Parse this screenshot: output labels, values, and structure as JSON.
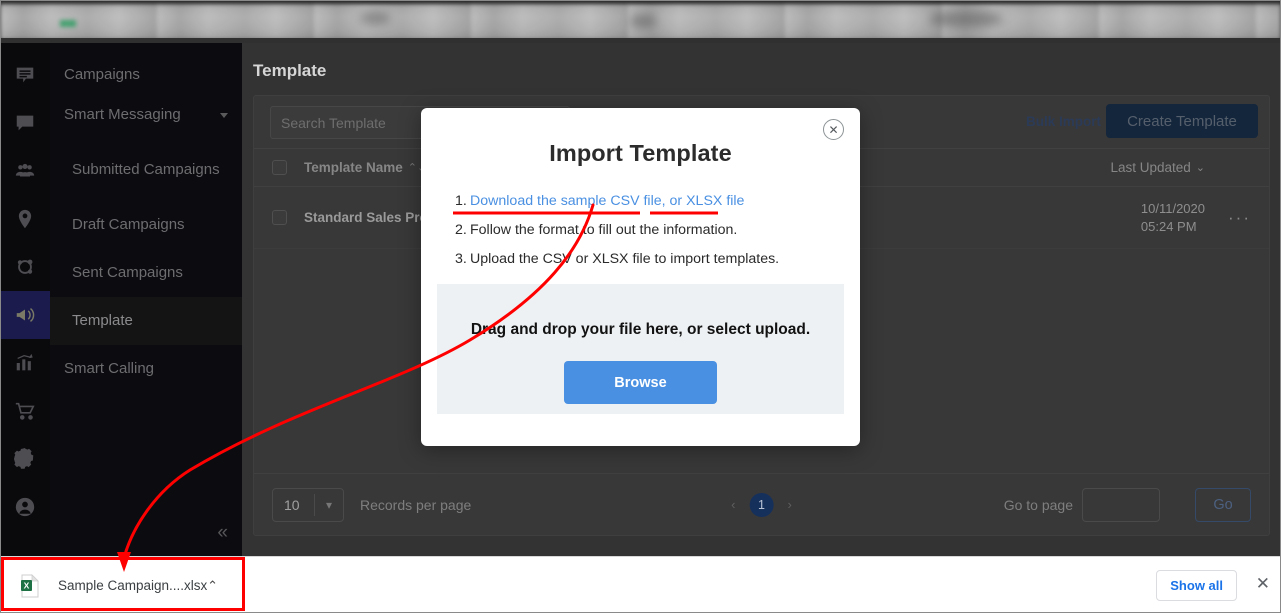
{
  "browser": {
    "chrome_note": "blurred-toolbar"
  },
  "sidebar": {
    "rail_icons": [
      {
        "name": "message-list-icon"
      },
      {
        "name": "chat-bubble-icon"
      },
      {
        "name": "people-group-icon"
      },
      {
        "name": "location-pin-icon"
      },
      {
        "name": "share-network-icon"
      },
      {
        "name": "megaphone-icon",
        "active": true
      },
      {
        "name": "bar-chart-icon"
      },
      {
        "name": "shopping-cart-icon"
      },
      {
        "name": "gear-icon"
      },
      {
        "name": "user-account-icon"
      }
    ],
    "items": [
      {
        "label": "Campaigns",
        "active": false,
        "sub": false,
        "caret": false
      },
      {
        "label": "Smart Messaging",
        "active": false,
        "sub": false,
        "caret": true
      },
      {
        "label": "Submitted Campaigns",
        "active": false,
        "sub": true,
        "caret": false
      },
      {
        "label": "Draft Campaigns",
        "active": false,
        "sub": true,
        "caret": false
      },
      {
        "label": "Sent Campaigns",
        "active": false,
        "sub": true,
        "caret": false
      },
      {
        "label": "Template",
        "active": true,
        "sub": true,
        "caret": false
      },
      {
        "label": "Smart Calling",
        "active": false,
        "sub": false,
        "caret": false
      }
    ],
    "collapse_label": "«"
  },
  "main": {
    "page_title": "Template",
    "search_placeholder": "Search Template",
    "bulk_import_label": "Bulk Import",
    "create_template_label": "Create Template",
    "table": {
      "columns": [
        {
          "label": "Template Name",
          "sort_icon": "⌃⌄"
        },
        {
          "label": "Last Updated",
          "chevron": "⌄"
        }
      ],
      "rows": [
        {
          "name": "Standard Sales Promo",
          "date": "10/11/2020",
          "time": "05:24 PM",
          "more": "···"
        }
      ]
    },
    "pagination": {
      "per_page_value": "10",
      "per_page_label": "Records per page",
      "prev_arrow": "‹",
      "current_page": "1",
      "next_arrow": "›",
      "goto_label": "Go to page",
      "goto_value": "",
      "go_label": "Go"
    }
  },
  "modal": {
    "title": "Import Template",
    "close_icon": "✕",
    "steps": [
      {
        "num": "1.",
        "link1": "Download the sample CSV file",
        "mid": ", or ",
        "link2": "XLSX file"
      },
      {
        "num": "2.",
        "text": "Follow the format to fill out the information."
      },
      {
        "num": "3.",
        "text": "Upload the CSV or XLSX file to import templates."
      }
    ],
    "dropzone_text": "Drag and drop your file here, or select upload.",
    "browse_label": "Browse"
  },
  "downloads_shelf": {
    "file_name": "Sample Campaign....xlsx",
    "file_icon": "excel-file-icon",
    "chevron": "⌃",
    "show_all_label": "Show all",
    "close_icon": "✕"
  },
  "colors": {
    "accent_blue": "#4a90e2",
    "link_blue": "#1a73e8",
    "annotation_red": "#ff0000",
    "sidebar_bg": "#0c0c10",
    "active_nav_bg": "#1b1b4d",
    "page_badge": "#16305c"
  }
}
